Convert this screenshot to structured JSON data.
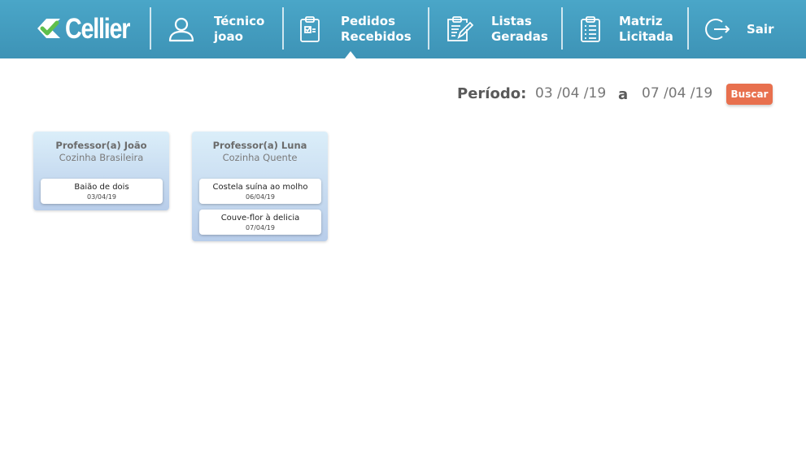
{
  "header": {
    "logo_text": "Cellier",
    "nav": [
      {
        "line1": "Técnico",
        "line2": "joao",
        "icon": "user-icon"
      },
      {
        "line1": "Pedidos",
        "line2": "Recebidos",
        "icon": "clipboard-check-icon",
        "active": true
      },
      {
        "line1": "Listas",
        "line2": "Geradas",
        "icon": "clipboard-edit-icon"
      },
      {
        "line1": "Matriz",
        "line2": "Licitada",
        "icon": "clipboard-list-icon"
      },
      {
        "line1": "Sair",
        "line2": "",
        "icon": "logout-icon"
      }
    ]
  },
  "period": {
    "label": "Período:",
    "from": "03 /04 /19",
    "separator": "a",
    "to": "07 /04 /19",
    "search_label": "Buscar"
  },
  "cards": [
    {
      "professor": "Professor(a) João",
      "kitchen": "Cozinha Brasileira",
      "orders": [
        {
          "name": "Baião de dois",
          "date": "03/04/19"
        }
      ]
    },
    {
      "professor": "Professor(a) Luna",
      "kitchen": "Cozinha Quente",
      "orders": [
        {
          "name": "Costela suína ao molho",
          "date": "06/04/19"
        },
        {
          "name": "Couve-flor à delicia",
          "date": "07/04/19"
        }
      ]
    }
  ],
  "colors": {
    "header": "#4aa6c8",
    "accent": "#e8704e",
    "logo_check": "#5fbf4c",
    "card_top": "#dbeef9",
    "card_bottom": "#b8cdea"
  }
}
